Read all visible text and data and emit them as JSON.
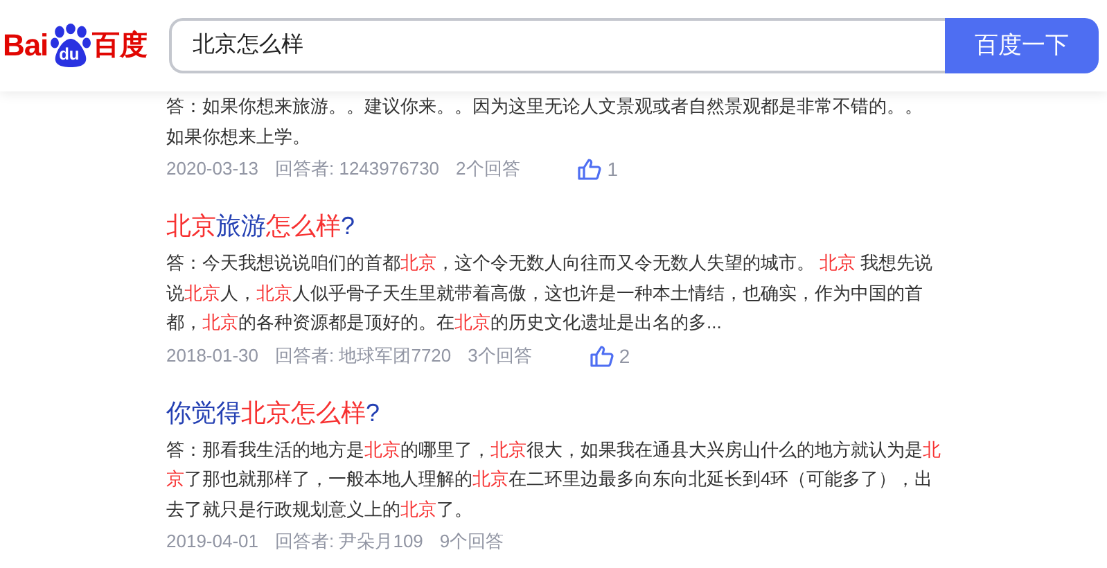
{
  "logo": {
    "left": "Bai",
    "paw_text": "du",
    "right": "百度"
  },
  "search": {
    "value": "北京怎么样",
    "button": "百度一下"
  },
  "results": [
    {
      "lines": [
        [
          {
            "text": "答：如果你想来旅游。。建议你来。。因为这里无论人文景观或者自然景观都是非常不错的。。",
            "highlight": false
          }
        ],
        [
          {
            "text": "如果你想来上学。",
            "highlight": false
          }
        ]
      ],
      "date": "2020-03-13",
      "answerer": "回答者: 1243976730",
      "answers": "2个回答",
      "likes": "1"
    },
    {
      "title": [
        {
          "text": "北京",
          "highlight": true
        },
        {
          "text": "旅游",
          "highlight": false
        },
        {
          "text": "怎么样",
          "highlight": true
        },
        {
          "text": "?",
          "highlight": false
        }
      ],
      "lines": [
        [
          {
            "text": "答：今天我想说说咱们的首都",
            "highlight": false
          },
          {
            "text": "北京",
            "highlight": true
          },
          {
            "text": "，这个令无数人向往而又令无数人失望的城市。 ",
            "highlight": false
          },
          {
            "text": "北京",
            "highlight": true
          },
          {
            "text": " 我想先说",
            "highlight": false
          }
        ],
        [
          {
            "text": "说",
            "highlight": false
          },
          {
            "text": "北京",
            "highlight": true
          },
          {
            "text": "人，",
            "highlight": false
          },
          {
            "text": "北京",
            "highlight": true
          },
          {
            "text": "人似乎骨子天生里就带着高傲，这也许是一种本土情结，也确实，作为中国的首",
            "highlight": false
          }
        ],
        [
          {
            "text": "都，",
            "highlight": false
          },
          {
            "text": "北京",
            "highlight": true
          },
          {
            "text": "的各种资源都是顶好的。在",
            "highlight": false
          },
          {
            "text": "北京",
            "highlight": true
          },
          {
            "text": "的历史文化遗址是出名的多...",
            "highlight": false
          }
        ]
      ],
      "date": "2018-01-30",
      "answerer": "回答者: 地球军团7720",
      "answers": "3个回答",
      "likes": "2"
    },
    {
      "title": [
        {
          "text": "你觉得",
          "highlight": false
        },
        {
          "text": "北京怎么样",
          "highlight": true
        },
        {
          "text": "?",
          "highlight": false
        }
      ],
      "lines": [
        [
          {
            "text": "答：那看我生活的地方是",
            "highlight": false
          },
          {
            "text": "北京",
            "highlight": true
          },
          {
            "text": "的哪里了，",
            "highlight": false
          },
          {
            "text": "北京",
            "highlight": true
          },
          {
            "text": "很大，如果我在通县大兴房山什么的地方就认为是",
            "highlight": false
          },
          {
            "text": "北",
            "highlight": true
          }
        ],
        [
          {
            "text": "京",
            "highlight": true
          },
          {
            "text": "了那也就那样了，一般本地人理解的",
            "highlight": false
          },
          {
            "text": "北京",
            "highlight": true
          },
          {
            "text": "在二环里边最多向东向北延长到4环（可能多了），出",
            "highlight": false
          }
        ],
        [
          {
            "text": "去了就只是行政规划意义上的",
            "highlight": false
          },
          {
            "text": "北京",
            "highlight": true
          },
          {
            "text": "了。",
            "highlight": false
          }
        ]
      ],
      "date": "2019-04-01",
      "answerer": "回答者: 尹朵月109",
      "answers": "9个回答"
    }
  ]
}
